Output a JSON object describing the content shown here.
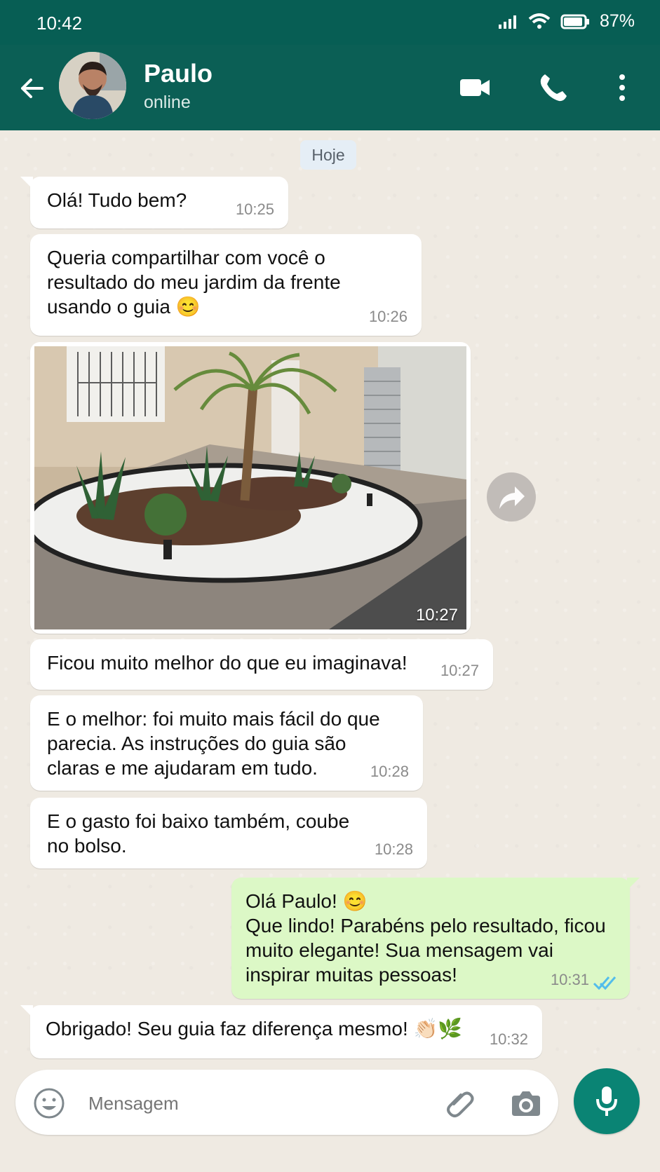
{
  "status_bar": {
    "time": "10:42",
    "battery": "87%",
    "icons": [
      "signal-icon",
      "wifi-icon",
      "battery-icon"
    ]
  },
  "header": {
    "contact_name": "Paulo",
    "presence": "online",
    "icons": [
      "back-arrow-icon",
      "video-call-icon",
      "phone-icon",
      "more-vert-icon"
    ]
  },
  "chat": {
    "day_label": "Hoje",
    "messages": [
      {
        "direction": "incoming",
        "text": "Olá! Tudo bem?",
        "time": "10:25"
      },
      {
        "direction": "incoming",
        "text": "Queria compartilhar com você o\nresultado do meu jardim da frente\nusando o guia 😊",
        "time": "10:26"
      },
      {
        "direction": "incoming",
        "type": "image",
        "image_description": "front garden landscaping with palm, shrubs and white stones",
        "time": "10:27"
      },
      {
        "direction": "incoming",
        "text": "Ficou muito melhor do que eu imaginava!",
        "time": "10:27"
      },
      {
        "direction": "incoming",
        "text": "E o melhor: foi muito mais fácil do que\nparecia. As instruções do guia são\nclaras e me ajudaram em tudo.",
        "time": "10:28"
      },
      {
        "direction": "incoming",
        "text": "E o gasto foi baixo também, coube\nno bolso.",
        "time": "10:28"
      },
      {
        "direction": "outgoing",
        "text": "Olá Paulo! 😊\nQue lindo! Parabéns pelo resultado, ficou\nmuito elegante! Sua mensagem vai\ninspirar muitas pessoas!",
        "time": "10:31",
        "read": true
      },
      {
        "direction": "incoming",
        "text": "Obrigado! Seu guia faz diferença mesmo! 👏🏻🌿",
        "time": "10:32"
      }
    ]
  },
  "composer": {
    "placeholder": "Mensagem",
    "icons": [
      "emoji-icon",
      "attach-icon",
      "camera-icon",
      "mic-icon"
    ]
  },
  "colors": {
    "header_green": "#0b5f55",
    "chat_background": "#efeae2",
    "outgoing_bubble": "#dcf8c6",
    "incoming_bubble": "#ffffff",
    "mic_button": "#0a8474",
    "read_ticks": "#53bdeb"
  }
}
